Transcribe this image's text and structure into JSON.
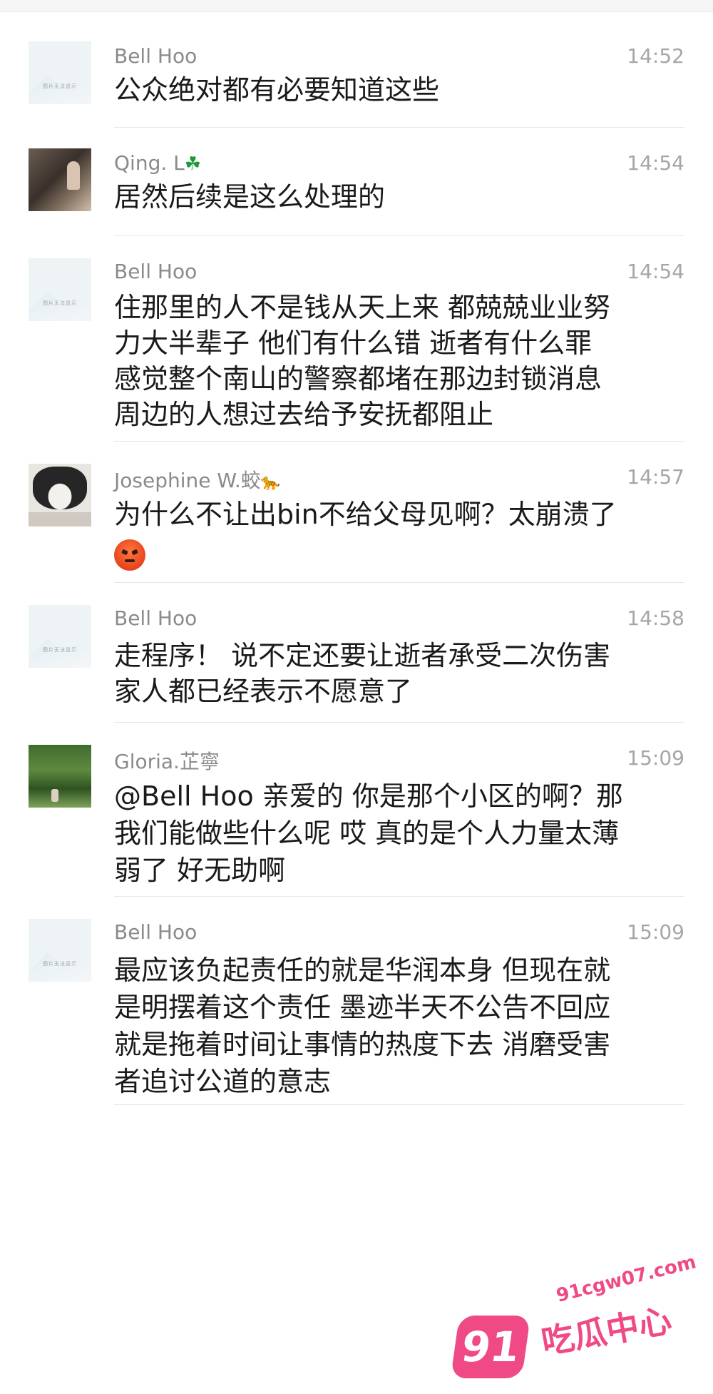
{
  "comments": [
    {
      "author": "Bell Hoo",
      "time": "14:52",
      "avatar": "placeholder-avatar",
      "avatar_text": "图片无法显示",
      "lines": [
        "公众绝对都有必要知道这些"
      ]
    },
    {
      "author": "Qing. L",
      "author_emoji": "☘️",
      "time": "14:54",
      "avatar": "room-photo-avatar",
      "lines": [
        "居然后续是这么处理的"
      ]
    },
    {
      "author": "Bell Hoo",
      "time": "14:54",
      "avatar": "placeholder-avatar",
      "avatar_text": "图片无法显示",
      "lines": [
        "住那里的人不是钱从天上来 都兢兢业业努",
        "力大半辈子 他们有什么错 逝者有什么罪",
        "感觉整个南山的警察都堵在那边封锁消息",
        "周边的人想过去给予安抚都阻止"
      ]
    },
    {
      "author": "Josephine W.蛟",
      "author_emoji": "🐆",
      "time": "14:57",
      "avatar": "cat-photo-avatar",
      "lines": [
        "为什么不让出bin不给父母见啊？太崩溃了"
      ],
      "trailing_emoji": "angry-face"
    },
    {
      "author": "Bell Hoo",
      "time": "14:58",
      "avatar": "placeholder-avatar",
      "avatar_text": "图片无法显示",
      "lines": [
        "走程序！ 说不定还要让逝者承受二次伤害",
        "家人都已经表示不愿意了"
      ]
    },
    {
      "author": "Gloria.芷寧",
      "time": "15:09",
      "avatar": "garden-photo-avatar",
      "lines": [
        "@Bell Hoo 亲爱的 你是那个小区的啊？那",
        "我们能做些什么呢 哎 真的是个人力量太薄",
        "弱了 好无助啊"
      ]
    },
    {
      "author": "Bell Hoo",
      "time": "15:09",
      "avatar": "placeholder-avatar",
      "avatar_text": "图片无法显示",
      "lines": [
        "最应该负起责任的就是华润本身 但现在就",
        "是明摆着这个责任 墨迹半天不公告不回应",
        "就是拖着时间让事情的热度下去 消磨受害",
        "者追讨公道的意志"
      ]
    }
  ],
  "watermark": {
    "badge": "91",
    "title": "吃瓜中心",
    "domain": "91cgw07.com",
    "color": "#f04a86"
  }
}
